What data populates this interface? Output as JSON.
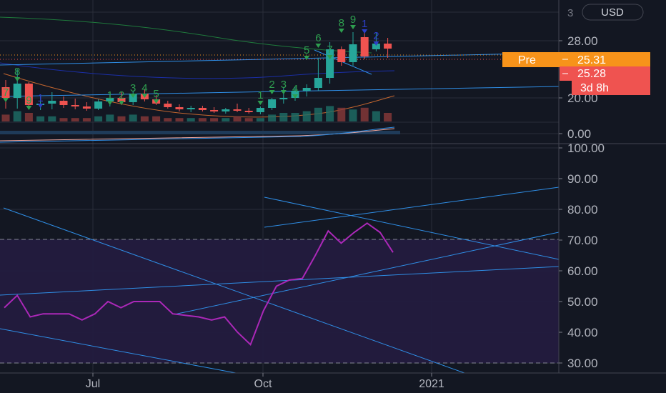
{
  "header": {
    "currency": "USD"
  },
  "badges": {
    "pre_label": "Pre",
    "pre_price": "25.31",
    "last_price": "25.28",
    "countdown": "3d 8h"
  },
  "colors": {
    "background": "#131722",
    "grid": "#2a2e39",
    "up_candle": "#26a69a",
    "down_candle": "#ef5350",
    "pre_badge": "#f7931a",
    "last_badge": "#ef5350",
    "rsi_line": "#ab28b8",
    "rsi_band": "#2a1e48",
    "trendline": "#2f8ee6",
    "td_count": "#2e9e4f",
    "td_count_alt": "#2c3ec9"
  },
  "chart_data": [
    {
      "type": "candlestick",
      "title": "",
      "price_axis_ticks": [
        "28.00",
        "20.00",
        "0.00"
      ],
      "top_partial_tick": "3",
      "x_ticks": [
        "Jul",
        "Oct",
        "2021"
      ],
      "candles": [
        {
          "o": 21.5,
          "h": 22.5,
          "l": 18.5,
          "c": 20.0
        },
        {
          "o": 20.0,
          "h": 24.0,
          "l": 18.5,
          "c": 22.0
        },
        {
          "o": 22.0,
          "h": 22.2,
          "l": 18.5,
          "c": 19.0
        },
        {
          "o": 19.0,
          "h": 20.5,
          "l": 18.3,
          "c": 19.2
        },
        {
          "o": 19.2,
          "h": 20.8,
          "l": 18.4,
          "c": 19.6
        },
        {
          "o": 19.6,
          "h": 20.2,
          "l": 18.6,
          "c": 19.0
        },
        {
          "o": 19.0,
          "h": 19.9,
          "l": 18.4,
          "c": 18.8
        },
        {
          "o": 18.8,
          "h": 19.4,
          "l": 18.2,
          "c": 18.5
        },
        {
          "o": 18.5,
          "h": 19.8,
          "l": 18.3,
          "c": 19.5
        },
        {
          "o": 19.5,
          "h": 20.6,
          "l": 18.8,
          "c": 20.0
        },
        {
          "o": 20.0,
          "h": 20.8,
          "l": 19.0,
          "c": 19.4
        },
        {
          "o": 19.4,
          "h": 21.0,
          "l": 19.0,
          "c": 20.6
        },
        {
          "o": 20.6,
          "h": 21.2,
          "l": 19.5,
          "c": 19.8
        },
        {
          "o": 19.8,
          "h": 20.4,
          "l": 19.0,
          "c": 19.2
        },
        {
          "o": 19.2,
          "h": 19.6,
          "l": 18.5,
          "c": 18.7
        },
        {
          "o": 18.7,
          "h": 19.1,
          "l": 18.1,
          "c": 18.4
        },
        {
          "o": 18.4,
          "h": 18.9,
          "l": 18.0,
          "c": 18.6
        },
        {
          "o": 18.6,
          "h": 18.9,
          "l": 18.1,
          "c": 18.3
        },
        {
          "o": 18.3,
          "h": 18.7,
          "l": 17.9,
          "c": 18.1
        },
        {
          "o": 18.1,
          "h": 18.6,
          "l": 17.8,
          "c": 18.4
        },
        {
          "o": 18.4,
          "h": 19.2,
          "l": 18.0,
          "c": 18.2
        },
        {
          "o": 18.2,
          "h": 18.6,
          "l": 17.8,
          "c": 18.0
        },
        {
          "o": 18.0,
          "h": 18.8,
          "l": 17.7,
          "c": 18.6
        },
        {
          "o": 18.6,
          "h": 20.0,
          "l": 18.3,
          "c": 19.8
        },
        {
          "o": 19.8,
          "h": 21.5,
          "l": 19.2,
          "c": 20.0
        },
        {
          "o": 20.0,
          "h": 21.6,
          "l": 19.6,
          "c": 21.0
        },
        {
          "o": 21.0,
          "h": 21.9,
          "l": 20.2,
          "c": 21.4
        },
        {
          "o": 21.4,
          "h": 25.6,
          "l": 21.0,
          "c": 22.8
        },
        {
          "o": 22.8,
          "h": 27.8,
          "l": 22.0,
          "c": 26.8
        },
        {
          "o": 26.8,
          "h": 27.2,
          "l": 24.5,
          "c": 25.0
        },
        {
          "o": 25.0,
          "h": 29.2,
          "l": 24.5,
          "c": 27.5
        },
        {
          "o": 28.5,
          "h": 29.3,
          "l": 25.4,
          "c": 25.8
        },
        {
          "o": 26.8,
          "h": 29.1,
          "l": 26.5,
          "c": 27.6
        },
        {
          "o": 27.6,
          "h": 28.4,
          "l": 25.6,
          "c": 26.9
        }
      ],
      "volume": [
        4,
        6,
        5,
        3,
        3,
        2,
        2,
        2,
        3,
        4,
        3,
        4,
        3,
        3,
        2,
        2,
        2,
        2,
        2,
        2,
        3,
        2,
        2,
        4,
        5,
        5,
        6,
        8,
        9,
        8,
        7,
        8,
        6,
        5
      ],
      "td_sequential_labels": [
        "7",
        "8",
        "9",
        "1",
        "1",
        "2",
        "3",
        "4",
        "5",
        "1",
        "2",
        "3",
        "4",
        "5",
        "6",
        "7",
        "8",
        "9",
        "1",
        "2"
      ],
      "price_badges": {
        "pre_market": 25.31,
        "last": 25.28
      }
    },
    {
      "type": "line",
      "title": "",
      "y_ticks": [
        "100.00",
        "90.00",
        "80.00",
        "70.00",
        "60.00",
        "50.00",
        "40.00",
        "30.00"
      ],
      "ylim": [
        30,
        100
      ],
      "overbought": 70,
      "oversold": 30,
      "series": [
        {
          "values": [
            48,
            52,
            45,
            46,
            46,
            46,
            44,
            46,
            50,
            48,
            50,
            50,
            50,
            46,
            45.5,
            45,
            44,
            45,
            40,
            36,
            47,
            55,
            57,
            57.5,
            65,
            73,
            69,
            72.5,
            75.5,
            72.5,
            66
          ]
        }
      ]
    }
  ]
}
